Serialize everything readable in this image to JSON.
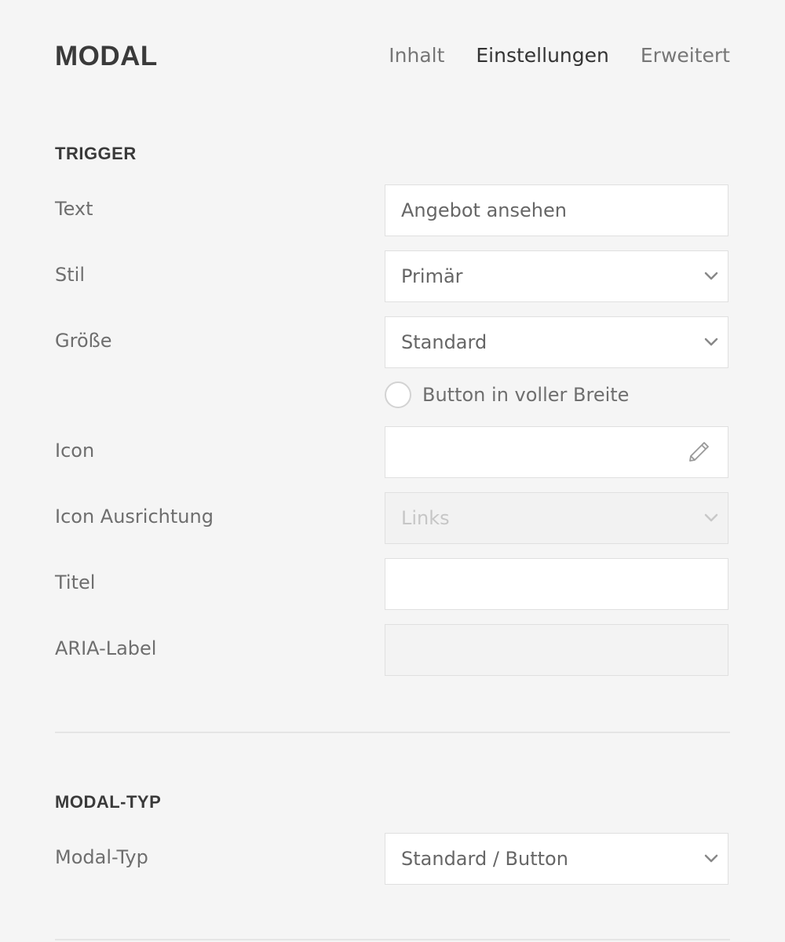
{
  "header": {
    "title": "MODAL",
    "tabs": [
      {
        "label": "Inhalt",
        "active": false
      },
      {
        "label": "Einstellungen",
        "active": true
      },
      {
        "label": "Erweitert",
        "active": false
      }
    ]
  },
  "trigger": {
    "heading": "TRIGGER",
    "text": {
      "label": "Text",
      "value": "Angebot ansehen"
    },
    "style": {
      "label": "Stil",
      "value": "Primär"
    },
    "size": {
      "label": "Größe",
      "value": "Standard"
    },
    "full_width": {
      "label": "Button in voller Breite",
      "checked": false
    },
    "icon": {
      "label": "Icon",
      "value": ""
    },
    "icon_alignment": {
      "label": "Icon Ausrichtung",
      "value": "Links",
      "disabled": true
    },
    "title": {
      "label": "Titel",
      "value": ""
    },
    "aria_label": {
      "label": "ARIA-Label",
      "value": ""
    }
  },
  "modal_type": {
    "heading": "MODAL-TYP",
    "type": {
      "label": "Modal-Typ",
      "value": "Standard / Button"
    }
  },
  "colors": {
    "background": "#f5f5f5",
    "heading": "#3a3a3a",
    "label": "#6e6e6e",
    "field_border": "#e0e0e0",
    "disabled_text": "#c6c6c6"
  },
  "icons": {
    "select": "chevron-down-icon",
    "icon_picker": "pencil-icon",
    "toggle": "radio-circle"
  }
}
